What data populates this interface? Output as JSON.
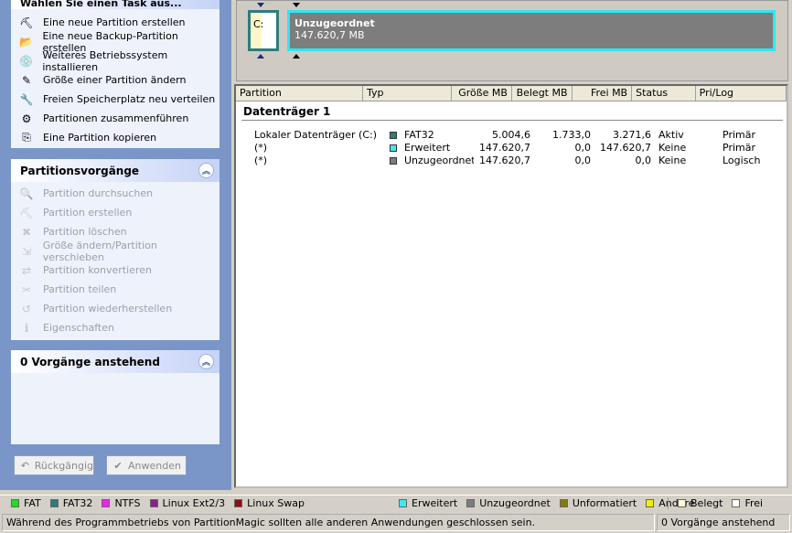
{
  "tasks_header": "Wählen Sie einen Task aus...",
  "tasks": [
    {
      "label": "Eine neue Partition erstellen",
      "icon": "new-partition-icon",
      "glyph": "⛏"
    },
    {
      "label": "Eine neue Backup-Partition erstellen",
      "icon": "backup-folder-icon",
      "glyph": "📂"
    },
    {
      "label": "Weiteres Betriebssystem installieren",
      "icon": "install-os-icon",
      "glyph": "💿"
    },
    {
      "label": "Größe einer Partition ändern",
      "icon": "resize-icon",
      "glyph": "✎"
    },
    {
      "label": "Freien Speicherplatz neu verteilen",
      "icon": "redistribute-icon",
      "glyph": "🔧"
    },
    {
      "label": "Partitionen zusammenführen",
      "icon": "merge-icon",
      "glyph": "⚙"
    },
    {
      "label": "Eine Partition kopieren",
      "icon": "copy-icon",
      "glyph": "⎘"
    }
  ],
  "ops_header": "Partitionsvorgänge",
  "ops": [
    {
      "label": "Partition durchsuchen",
      "icon": "browse-icon",
      "glyph": "🔍"
    },
    {
      "label": "Partition erstellen",
      "icon": "create-icon",
      "glyph": "⛏"
    },
    {
      "label": "Partition löschen",
      "icon": "delete-icon",
      "glyph": "✖"
    },
    {
      "label": "Größe ändern/Partition verschieben",
      "icon": "resize-move-icon",
      "glyph": "⇲"
    },
    {
      "label": "Partition konvertieren",
      "icon": "convert-icon",
      "glyph": "⇄"
    },
    {
      "label": "Partition teilen",
      "icon": "split-icon",
      "glyph": "✂"
    },
    {
      "label": "Partition wiederherstellen",
      "icon": "restore-icon",
      "glyph": "↺"
    },
    {
      "label": "Eigenschaften",
      "icon": "properties-icon",
      "glyph": "ℹ"
    }
  ],
  "pending_header": "0 Vorgänge anstehend",
  "buttons": {
    "undo": "Rückgängig",
    "apply": "Anwenden"
  },
  "diskmap": {
    "c_label": "C:",
    "unalloc_title": "Unzugeordnet",
    "unalloc_size": "147.620,7 MB"
  },
  "table": {
    "columns": [
      "Partition",
      "Typ",
      "Größe MB",
      "Belegt MB",
      "Frei MB",
      "Status",
      "Pri/Log"
    ],
    "disk_label": "Datenträger 1",
    "rows": [
      {
        "partition": "Lokaler Datenträger (C:)",
        "type": "FAT32",
        "color": "#2e7c7e",
        "size": "5.004,6",
        "used": "1.733,0",
        "free": "3.271,6",
        "status": "Aktiv",
        "prilog": "Primär"
      },
      {
        "partition": "(*)",
        "type": "Erweitert",
        "color": "#40e8f0",
        "size": "147.620,7",
        "used": "0,0",
        "free": "147.620,7",
        "status": "Keine",
        "prilog": "Primär"
      },
      {
        "partition": "(*)",
        "type": "Unzugeordnet",
        "color": "#7d7d7d",
        "size": "147.620,7",
        "used": "0,0",
        "free": "0,0",
        "status": "Keine",
        "prilog": "Logisch"
      }
    ]
  },
  "legend": [
    {
      "label": "FAT",
      "color": "#22dd22"
    },
    {
      "label": "FAT32",
      "color": "#2e7c7e"
    },
    {
      "label": "NTFS",
      "color": "#ee22ee"
    },
    {
      "label": "Linux Ext2/3",
      "color": "#882288"
    },
    {
      "label": "Linux Swap",
      "color": "#881111"
    }
  ],
  "legend_right": [
    {
      "label": "Erweitert",
      "color": "#40e8f0"
    },
    {
      "label": "Unzugeordnet",
      "color": "#7d7d7d"
    },
    {
      "label": "Unformatiert",
      "color": "#808000"
    },
    {
      "label": "Andere",
      "color": "#f0f000"
    }
  ],
  "legend_usage": [
    {
      "label": "Belegt",
      "color": "#fffbd6"
    },
    {
      "label": "Frei",
      "color": "#ffffff"
    }
  ],
  "status": {
    "message": "Während des Programmbetriebs von PartitionMagic sollten alle anderen Anwendungen geschlossen sein.",
    "pending": "0 Vorgänge anstehend"
  }
}
